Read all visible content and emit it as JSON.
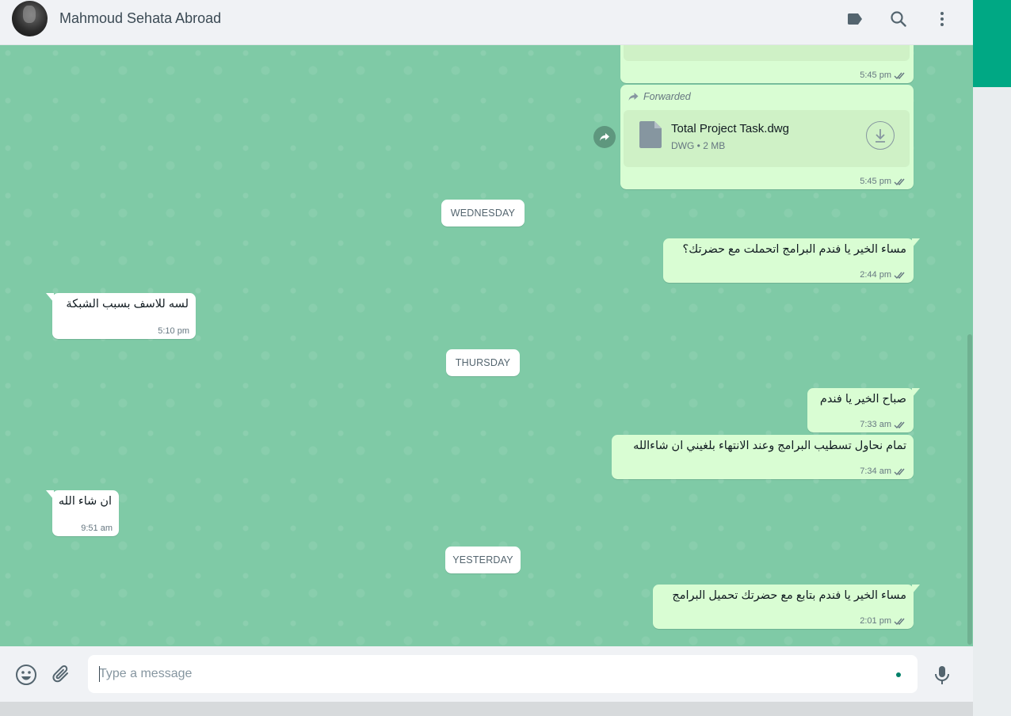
{
  "header": {
    "contact_name": "Mahmoud Sehata Abroad",
    "icons": [
      "label-icon",
      "search-icon",
      "menu-icon"
    ]
  },
  "colors": {
    "accent": "#00a884",
    "chat_background": "#7fcaa6",
    "outgoing_bubble": "#d9fdd3",
    "incoming_bubble": "#ffffff",
    "tick_color": "#667781"
  },
  "messages": {
    "m0": {
      "time": "5:45 pm"
    },
    "m1": {
      "forwarded_label": "Forwarded",
      "file_name": "Total Project Task.dwg",
      "file_info": "DWG • 2 MB",
      "time": "5:45 pm"
    },
    "day1": {
      "label": "WEDNESDAY"
    },
    "m2": {
      "text": "مساء الخير يا فندم البرامج  اتحملت مع حضرتك؟",
      "time": "2:44 pm"
    },
    "m3": {
      "text": "لسه للاسف بسبب الشبكة",
      "time": "5:10 pm"
    },
    "day2": {
      "label": "THURSDAY"
    },
    "m4": {
      "text": "صباح الخير يا فندم",
      "time": "7:33 am"
    },
    "m5": {
      "text": "تمام نحاول تسطيب البرامج وعند الانتهاء بلغيني ان شاءالله",
      "time": "7:34 am"
    },
    "m6": {
      "text": "ان شاء الله",
      "time": "9:51 am"
    },
    "day3": {
      "label": "YESTERDAY"
    },
    "m7": {
      "text": "مساء الخير يا فندم بتابع مع حضرتك تحميل البرامج",
      "time": "2:01 pm"
    }
  },
  "footer": {
    "placeholder": "Type a message",
    "icons": [
      "emoji-icon",
      "attach-icon",
      "mic-icon"
    ]
  }
}
